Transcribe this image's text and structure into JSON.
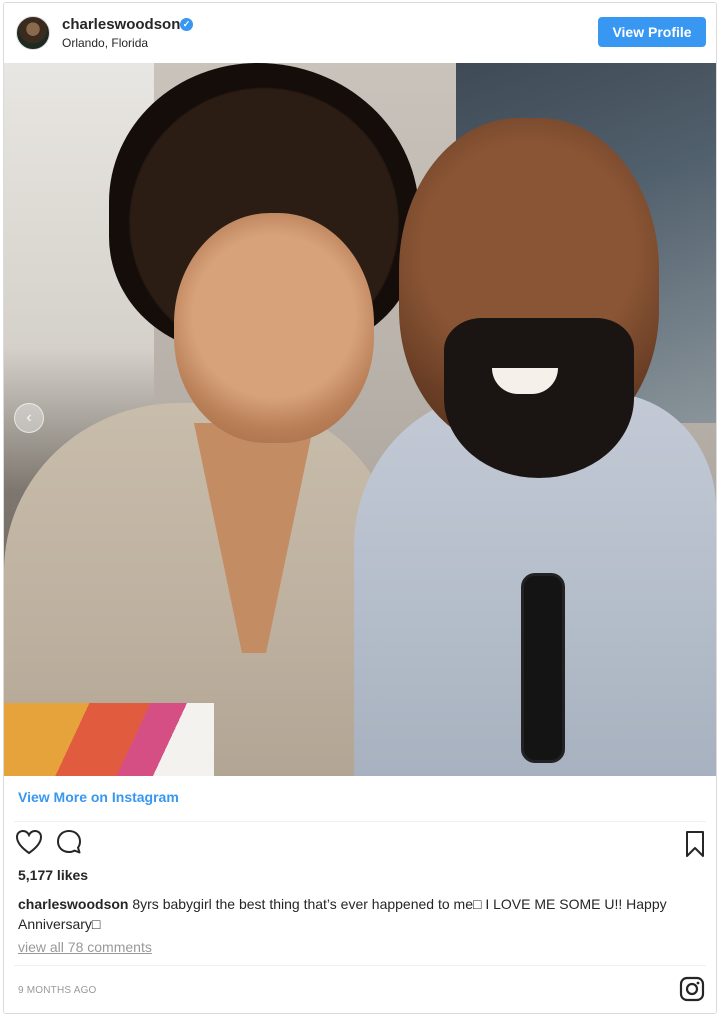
{
  "header": {
    "username": "charleswoodson",
    "verified_glyph": "✓",
    "location": "Orlando, Florida",
    "view_profile_label": "View Profile"
  },
  "post": {
    "carousel_prev_glyph": "‹",
    "view_more_label": "View More on Instagram",
    "likes": "5,177 likes",
    "caption_user": "charleswoodson",
    "caption_text": "8yrs babygirl the best thing that’s ever happened to me□ I LOVE ME SOME U!! Happy Anniversary□",
    "comments_link": "view all 78 comments",
    "timestamp": "9 MONTHS AGO"
  },
  "icons": {
    "like": "heart-icon",
    "comment": "comment-icon",
    "save": "bookmark-icon",
    "brand": "instagram-icon"
  },
  "colors": {
    "accent": "#3897f0",
    "text": "#262626",
    "muted": "#999999",
    "border": "#dbdbdb"
  }
}
